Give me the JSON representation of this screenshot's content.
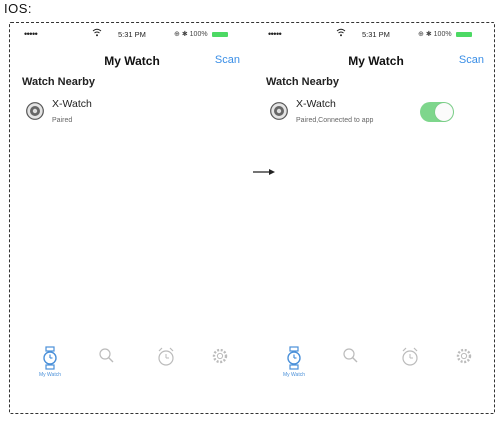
{
  "heading": "IOS:",
  "screens": [
    {
      "status": {
        "signal": "•••••",
        "time": "5:31 PM",
        "battery": "100%"
      },
      "nav": {
        "title": "My Watch",
        "scan": "Scan"
      },
      "section": "Watch Nearby",
      "device": {
        "name": "X-Watch",
        "status": "Paired"
      },
      "tabs": [
        {
          "icon": "watch-icon",
          "label": "My Watch",
          "active": true
        },
        {
          "icon": "search-icon",
          "active": false
        },
        {
          "icon": "alarm-clock-icon",
          "active": false
        },
        {
          "icon": "gear-icon",
          "active": false
        }
      ]
    },
    {
      "status": {
        "signal": "•••••",
        "time": "5:31 PM",
        "battery": "100%"
      },
      "nav": {
        "title": "My Watch",
        "scan": "Scan"
      },
      "section": "Watch Nearby",
      "device": {
        "name": "X-Watch",
        "status": "Paired,Connected to app",
        "connected": true
      },
      "tabs": [
        {
          "icon": "watch-icon",
          "label": "My Watch",
          "active": true
        },
        {
          "icon": "search-icon",
          "active": false
        },
        {
          "icon": "alarm-clock-icon",
          "active": false
        },
        {
          "icon": "gear-icon",
          "active": false
        }
      ]
    }
  ],
  "colors": {
    "accent": "#3a8ee6",
    "toggle_on": "#7ed68c",
    "battery": "#4cd964"
  }
}
